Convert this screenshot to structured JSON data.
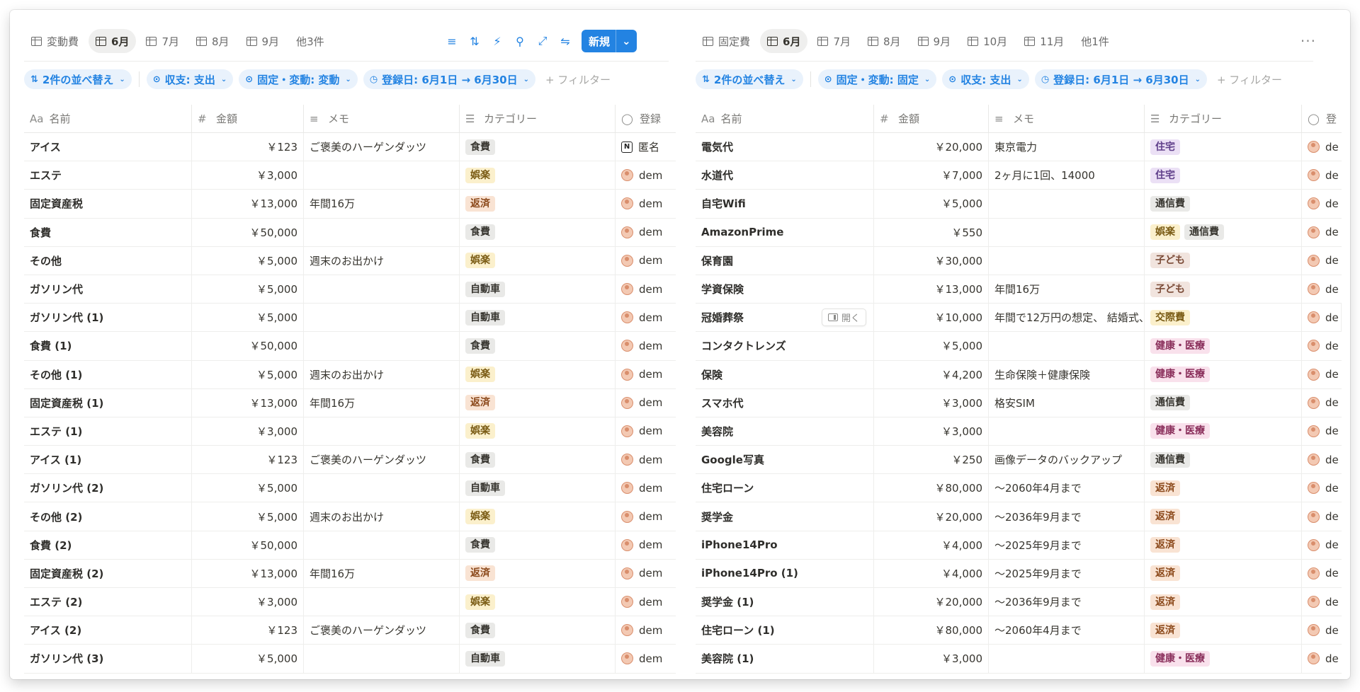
{
  "left": {
    "tabs": [
      {
        "label": "変動費",
        "active": false
      },
      {
        "label": "6月",
        "active": true
      },
      {
        "label": "7月",
        "active": false
      },
      {
        "label": "8月",
        "active": false
      },
      {
        "label": "9月",
        "active": false
      }
    ],
    "more_views": "他3件",
    "new_button": "新規",
    "filters": [
      {
        "label": "2件の並べ替え",
        "icon": "sort-icon"
      },
      {
        "label": "収支: 支出",
        "icon": "filter-icon"
      },
      {
        "label": "固定・変動: 変動",
        "icon": "filter-icon"
      },
      {
        "label": "登録日: 6月1日 → 6月30日",
        "icon": "clock-icon"
      }
    ],
    "add_filter": "+ フィルター",
    "columns": [
      {
        "label": "名前",
        "icon": "Aa"
      },
      {
        "label": "金額",
        "icon": "#"
      },
      {
        "label": "メモ",
        "icon": "≡"
      },
      {
        "label": "カテゴリー",
        "icon": "☰"
      },
      {
        "label": "登録",
        "icon": "◯"
      }
    ],
    "rows": [
      {
        "name": "アイス",
        "amount": "￥123",
        "memo": "ご褒美のハーゲンダッツ",
        "tags": [
          {
            "label": "食費",
            "color": "gray"
          }
        ],
        "creator": "匿名",
        "creator_icon": "notion"
      },
      {
        "name": "エステ",
        "amount": "￥3,000",
        "memo": "",
        "tags": [
          {
            "label": "娯楽",
            "color": "yellow"
          }
        ],
        "creator": "dem"
      },
      {
        "name": "固定資産税",
        "amount": "￥13,000",
        "memo": "年間16万",
        "tags": [
          {
            "label": "返済",
            "color": "orange"
          }
        ],
        "creator": "dem"
      },
      {
        "name": "食費",
        "amount": "￥50,000",
        "memo": "",
        "tags": [
          {
            "label": "食費",
            "color": "gray"
          }
        ],
        "creator": "dem"
      },
      {
        "name": "その他",
        "amount": "￥5,000",
        "memo": "週末のお出かけ",
        "tags": [
          {
            "label": "娯楽",
            "color": "yellow"
          }
        ],
        "creator": "dem"
      },
      {
        "name": "ガソリン代",
        "amount": "￥5,000",
        "memo": "",
        "tags": [
          {
            "label": "自動車",
            "color": "gray"
          }
        ],
        "creator": "dem"
      },
      {
        "name": "ガソリン代 (1)",
        "amount": "￥5,000",
        "memo": "",
        "tags": [
          {
            "label": "自動車",
            "color": "gray"
          }
        ],
        "creator": "dem"
      },
      {
        "name": "食費 (1)",
        "amount": "￥50,000",
        "memo": "",
        "tags": [
          {
            "label": "食費",
            "color": "gray"
          }
        ],
        "creator": "dem"
      },
      {
        "name": "その他 (1)",
        "amount": "￥5,000",
        "memo": "週末のお出かけ",
        "tags": [
          {
            "label": "娯楽",
            "color": "yellow"
          }
        ],
        "creator": "dem"
      },
      {
        "name": "固定資産税 (1)",
        "amount": "￥13,000",
        "memo": "年間16万",
        "tags": [
          {
            "label": "返済",
            "color": "orange"
          }
        ],
        "creator": "dem"
      },
      {
        "name": "エステ (1)",
        "amount": "￥3,000",
        "memo": "",
        "tags": [
          {
            "label": "娯楽",
            "color": "yellow"
          }
        ],
        "creator": "dem"
      },
      {
        "name": "アイス (1)",
        "amount": "￥123",
        "memo": "ご褒美のハーゲンダッツ",
        "tags": [
          {
            "label": "食費",
            "color": "gray"
          }
        ],
        "creator": "dem"
      },
      {
        "name": "ガソリン代 (2)",
        "amount": "￥5,000",
        "memo": "",
        "tags": [
          {
            "label": "自動車",
            "color": "gray"
          }
        ],
        "creator": "dem"
      },
      {
        "name": "その他 (2)",
        "amount": "￥5,000",
        "memo": "週末のお出かけ",
        "tags": [
          {
            "label": "娯楽",
            "color": "yellow"
          }
        ],
        "creator": "dem"
      },
      {
        "name": "食費 (2)",
        "amount": "￥50,000",
        "memo": "",
        "tags": [
          {
            "label": "食費",
            "color": "gray"
          }
        ],
        "creator": "dem"
      },
      {
        "name": "固定資産税 (2)",
        "amount": "￥13,000",
        "memo": "年間16万",
        "tags": [
          {
            "label": "返済",
            "color": "orange"
          }
        ],
        "creator": "dem"
      },
      {
        "name": "エステ (2)",
        "amount": "￥3,000",
        "memo": "",
        "tags": [
          {
            "label": "娯楽",
            "color": "yellow"
          }
        ],
        "creator": "dem"
      },
      {
        "name": "アイス (2)",
        "amount": "￥123",
        "memo": "ご褒美のハーゲンダッツ",
        "tags": [
          {
            "label": "食費",
            "color": "gray"
          }
        ],
        "creator": "dem"
      },
      {
        "name": "ガソリン代 (3)",
        "amount": "￥5,000",
        "memo": "",
        "tags": [
          {
            "label": "自動車",
            "color": "gray"
          }
        ],
        "creator": "dem"
      }
    ]
  },
  "right": {
    "tabs": [
      {
        "label": "固定費",
        "active": false
      },
      {
        "label": "6月",
        "active": true
      },
      {
        "label": "7月",
        "active": false
      },
      {
        "label": "8月",
        "active": false
      },
      {
        "label": "9月",
        "active": false
      },
      {
        "label": "10月",
        "active": false
      },
      {
        "label": "11月",
        "active": false
      }
    ],
    "more_views": "他1件",
    "ellipsis": "···",
    "filters": [
      {
        "label": "2件の並べ替え",
        "icon": "sort-icon"
      },
      {
        "label": "固定・変動: 固定",
        "icon": "filter-icon"
      },
      {
        "label": "収支: 支出",
        "icon": "filter-icon"
      },
      {
        "label": "登録日: 6月1日 → 6月30日",
        "icon": "clock-icon"
      }
    ],
    "add_filter": "+ フィルター",
    "open_label": "開く",
    "columns": [
      {
        "label": "名前",
        "icon": "Aa"
      },
      {
        "label": "金額",
        "icon": "#"
      },
      {
        "label": "メモ",
        "icon": "≡"
      },
      {
        "label": "カテゴリー",
        "icon": "☰"
      },
      {
        "label": "登",
        "icon": "◯"
      }
    ],
    "rows": [
      {
        "name": "電気代",
        "amount": "￥20,000",
        "memo": "東京電力",
        "tags": [
          {
            "label": "住宅",
            "color": "purple"
          }
        ],
        "creator": "de"
      },
      {
        "name": "水道代",
        "amount": "￥7,000",
        "memo": "2ヶ月に1回、14000",
        "tags": [
          {
            "label": "住宅",
            "color": "purple"
          }
        ],
        "creator": "de"
      },
      {
        "name": "自宅Wifi",
        "amount": "￥5,000",
        "memo": "",
        "tags": [
          {
            "label": "通信費",
            "color": "gray"
          }
        ],
        "creator": "de"
      },
      {
        "name": "AmazonPrime",
        "amount": "￥550",
        "memo": "",
        "tags": [
          {
            "label": "娯楽",
            "color": "yellow"
          },
          {
            "label": "通信費",
            "color": "gray"
          }
        ],
        "creator": "de"
      },
      {
        "name": "保育園",
        "amount": "￥30,000",
        "memo": "",
        "tags": [
          {
            "label": "子ども",
            "color": "brown"
          }
        ],
        "creator": "de"
      },
      {
        "name": "学資保険",
        "amount": "￥13,000",
        "memo": "年間16万",
        "tags": [
          {
            "label": "子ども",
            "color": "brown"
          }
        ],
        "creator": "de"
      },
      {
        "name": "冠婚葬祭",
        "amount": "￥10,000",
        "memo": "年間で12万円の想定、 結婚式、",
        "tags": [
          {
            "label": "交際費",
            "color": "yellow"
          }
        ],
        "creator": "de",
        "hover": true
      },
      {
        "name": "コンタクトレンズ",
        "amount": "￥5,000",
        "memo": "",
        "tags": [
          {
            "label": "健康・医療",
            "color": "pink"
          }
        ],
        "creator": "de"
      },
      {
        "name": "保険",
        "amount": "￥4,200",
        "memo": "生命保険＋健康保険",
        "tags": [
          {
            "label": "健康・医療",
            "color": "pink"
          }
        ],
        "creator": "de"
      },
      {
        "name": "スマホ代",
        "amount": "￥3,000",
        "memo": "格安SIM",
        "tags": [
          {
            "label": "通信費",
            "color": "gray"
          }
        ],
        "creator": "de"
      },
      {
        "name": "美容院",
        "amount": "￥3,000",
        "memo": "",
        "tags": [
          {
            "label": "健康・医療",
            "color": "pink"
          }
        ],
        "creator": "de"
      },
      {
        "name": "Google写真",
        "amount": "￥250",
        "memo": "画像データのバックアップ",
        "tags": [
          {
            "label": "通信費",
            "color": "gray"
          }
        ],
        "creator": "de"
      },
      {
        "name": "住宅ローン",
        "amount": "￥80,000",
        "memo": "〜2060年4月まで",
        "tags": [
          {
            "label": "返済",
            "color": "orange"
          }
        ],
        "creator": "de"
      },
      {
        "name": "奨学金",
        "amount": "￥20,000",
        "memo": "〜2036年9月まで",
        "tags": [
          {
            "label": "返済",
            "color": "orange"
          }
        ],
        "creator": "de"
      },
      {
        "name": "iPhone14Pro",
        "amount": "￥4,000",
        "memo": "〜2025年9月まで",
        "tags": [
          {
            "label": "返済",
            "color": "orange"
          }
        ],
        "creator": "de"
      },
      {
        "name": "iPhone14Pro (1)",
        "amount": "￥4,000",
        "memo": "〜2025年9月まで",
        "tags": [
          {
            "label": "返済",
            "color": "orange"
          }
        ],
        "creator": "de"
      },
      {
        "name": "奨学金 (1)",
        "amount": "￥20,000",
        "memo": "〜2036年9月まで",
        "tags": [
          {
            "label": "返済",
            "color": "orange"
          }
        ],
        "creator": "de"
      },
      {
        "name": "住宅ローン (1)",
        "amount": "￥80,000",
        "memo": "〜2060年4月まで",
        "tags": [
          {
            "label": "返済",
            "color": "orange"
          }
        ],
        "creator": "de"
      },
      {
        "name": "美容院 (1)",
        "amount": "￥3,000",
        "memo": "",
        "tags": [
          {
            "label": "健康・医療",
            "color": "pink"
          }
        ],
        "creator": "de"
      }
    ]
  },
  "colors": {
    "accent": "#2383e2",
    "chip_bg": "#e9f2fc"
  }
}
